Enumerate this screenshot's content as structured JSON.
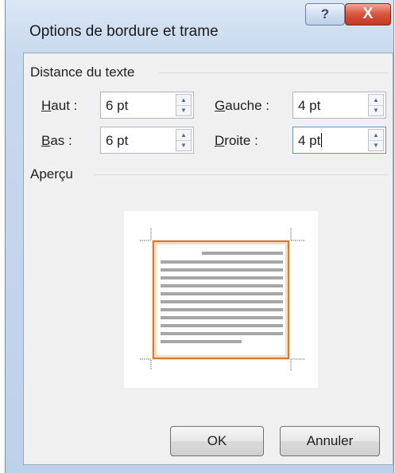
{
  "dialog": {
    "title": "Options de bordure et trame",
    "help_label": "?",
    "close_label": "X"
  },
  "spacing": {
    "group_label": "Distance du texte",
    "top": {
      "label_key": "H",
      "label_rest": "aut :",
      "value": "6 pt"
    },
    "bottom": {
      "label_key": "B",
      "label_rest": "as :",
      "value": "6 pt"
    },
    "left": {
      "label_key": "G",
      "label_rest": "auche :",
      "value": "4 pt"
    },
    "right": {
      "label_key": "D",
      "label_rest": "roite :",
      "value": "4 pt"
    }
  },
  "preview": {
    "group_label": "Aperçu",
    "border_color": "#d87a2e",
    "line_color": "#a6a6a6"
  },
  "buttons": {
    "ok": "OK",
    "cancel": "Annuler"
  }
}
